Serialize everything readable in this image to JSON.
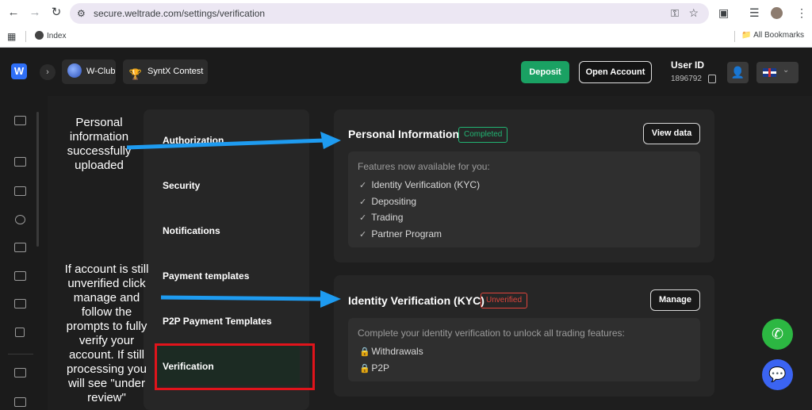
{
  "browser": {
    "url": "secure.weltrade.com/settings/verification",
    "bookmarks": {
      "index_label": "Index",
      "all_label": "All Bookmarks"
    }
  },
  "header": {
    "wclub_label": "W-Club",
    "contest_label": "SyntX Contest",
    "deposit_label": "Deposit",
    "open_account_label": "Open Account",
    "user_id_label": "User ID",
    "user_id_value": "1896792"
  },
  "settings_menu": {
    "items": [
      "Authorization",
      "Security",
      "Notifications",
      "Payment templates",
      "P2P Payment Templates",
      "Verification"
    ],
    "active": "Verification"
  },
  "personal_info": {
    "title": "Personal Information",
    "status": "Completed",
    "button": "View data",
    "features_title": "Features now available for you:",
    "features": [
      "Identity Verification (KYC)",
      "Depositing",
      "Trading",
      "Partner Program"
    ]
  },
  "kyc": {
    "title": "Identity Verification (KYC)",
    "status": "Unverified",
    "button": "Manage",
    "note": "Complete your identity verification to unlock all trading features:",
    "locked": [
      "Withdrawals",
      "P2P"
    ]
  },
  "annotations": {
    "top": [
      "Personal",
      "information",
      "successfully",
      "uploaded"
    ],
    "bottom": [
      "If account is still",
      "unverified click",
      "manage and",
      "follow the",
      "prompts to fully",
      "verify your",
      "account. If still",
      "processing you",
      "will see \"under",
      "review\""
    ]
  },
  "colors": {
    "accent_green": "#1aa163",
    "badge_green": "#22b573",
    "badge_red": "#e0443c",
    "highlight_red": "#e0141b",
    "arrow_blue": "#1e9bf0"
  }
}
